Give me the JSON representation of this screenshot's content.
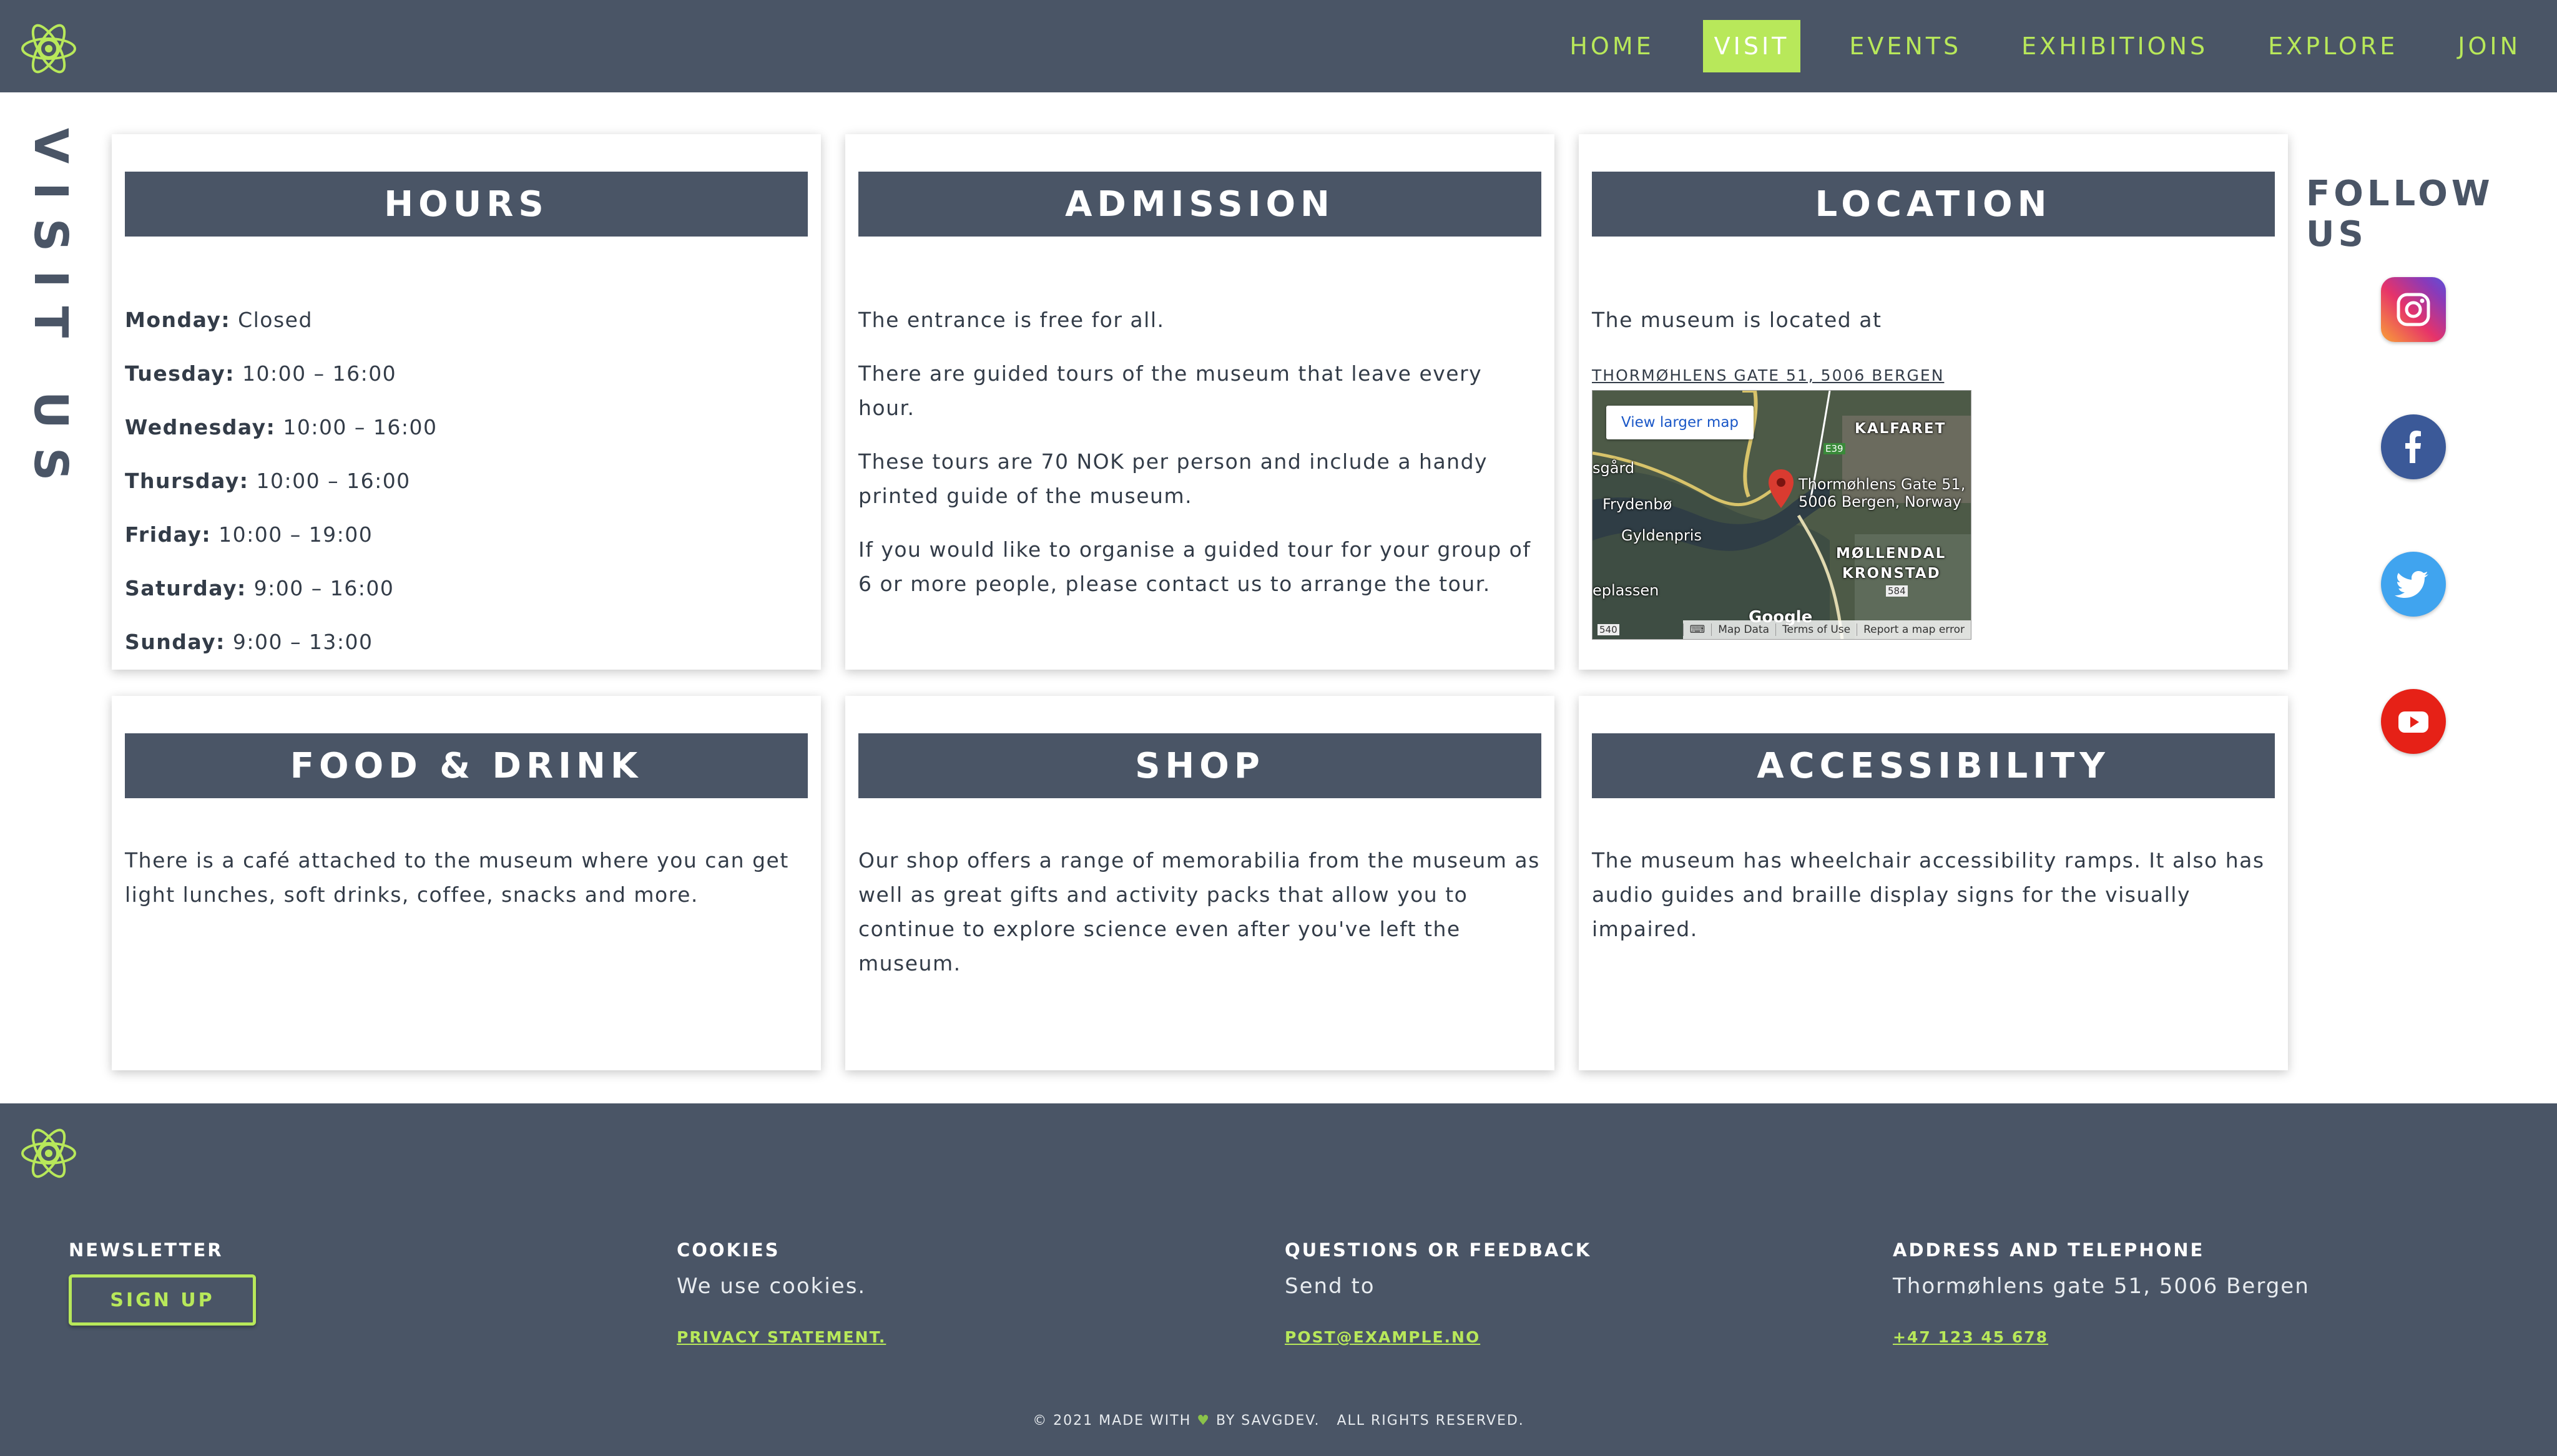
{
  "nav": {
    "items": [
      "HOME",
      "VISIT",
      "EVENTS",
      "EXHIBITIONS",
      "EXPLORE",
      "JOIN"
    ],
    "active": "VISIT"
  },
  "page": {
    "side_title": "VISIT US"
  },
  "hours": {
    "title": "HOURS",
    "days": [
      {
        "day": "Monday:",
        "time": "Closed"
      },
      {
        "day": "Tuesday:",
        "time": "10:00 – 16:00"
      },
      {
        "day": "Wednesday:",
        "time": "10:00 – 16:00"
      },
      {
        "day": "Thursday:",
        "time": "10:00 – 16:00"
      },
      {
        "day": "Friday:",
        "time": "10:00 – 19:00"
      },
      {
        "day": "Saturday:",
        "time": "9:00 – 16:00"
      },
      {
        "day": "Sunday:",
        "time": "9:00 – 13:00"
      }
    ]
  },
  "admission": {
    "title": "ADMISSION",
    "paragraphs": [
      "The entrance is free for all.",
      "There are guided tours of the museum that leave every hour.",
      "These tours are 70 NOK per person and include a handy printed guide of the museum.",
      "If you would like to organise a guided tour for your group of 6 or more people, please contact us to arrange the tour."
    ]
  },
  "location": {
    "title": "LOCATION",
    "intro": "The museum is located at",
    "address_link": "THORMØHLENS GATE 51, 5006 BERGEN",
    "map": {
      "button": "View larger map",
      "labels": {
        "kalfaret": "KALFARET",
        "sgard": "sgård",
        "frydenbo": "Frydenbø",
        "gyldenpris": "Gyldenpris",
        "pin_line1": "Thormøhlens Gate 51,",
        "pin_line2": "5006 Bergen, Norway",
        "mollendal": "MØLLENDAL",
        "kronstad": "KRONSTAD",
        "eplassen": "eplassen",
        "e39": "E39",
        "s584": "584",
        "s540": "540"
      },
      "footer": [
        "Map Data",
        "Terms of Use",
        "Report a map error"
      ],
      "google": "Google"
    }
  },
  "food": {
    "title": "FOOD & DRINK",
    "text": "There is a café attached to the museum where you can get light lunches, soft drinks, coffee, snacks and more."
  },
  "shop": {
    "title": "SHOP",
    "text": "Our shop offers a range of memorabilia from the museum as well as great gifts and activity packs that allow you to continue to explore science even after you've left the museum."
  },
  "accessibility": {
    "title": "ACCESSIBILITY",
    "text": "The museum has wheelchair accessibility ramps. It also has audio guides and braille display signs for the visually impaired."
  },
  "follow": {
    "title": "FOLLOW US",
    "icons": [
      "instagram-icon",
      "facebook-icon",
      "twitter-icon",
      "youtube-icon"
    ]
  },
  "footer": {
    "newsletter": {
      "heading": "NEWSLETTER",
      "button": "SIGN UP"
    },
    "cookies": {
      "heading": "COOKIES",
      "text": "We use cookies.",
      "link": "PRIVACY STATEMENT."
    },
    "feedback": {
      "heading": "QUESTIONS OR FEEDBACK",
      "text": "Send to",
      "link": "POST@EXAMPLE.NO"
    },
    "address": {
      "heading": "ADDRESS AND TELEPHONE",
      "text": "Thormøhlens gate 51, 5006 Bergen",
      "link": "+47 123 45 678"
    },
    "copyright_before": "© 2021 MADE WITH",
    "heart": "♥",
    "copyright_after": "BY SAVGDEV.   ALL RIGHTS RESERVED."
  },
  "colors": {
    "header_bg": "#4a5566",
    "accent": "#b8e85a",
    "text_dark": "#333c48"
  }
}
